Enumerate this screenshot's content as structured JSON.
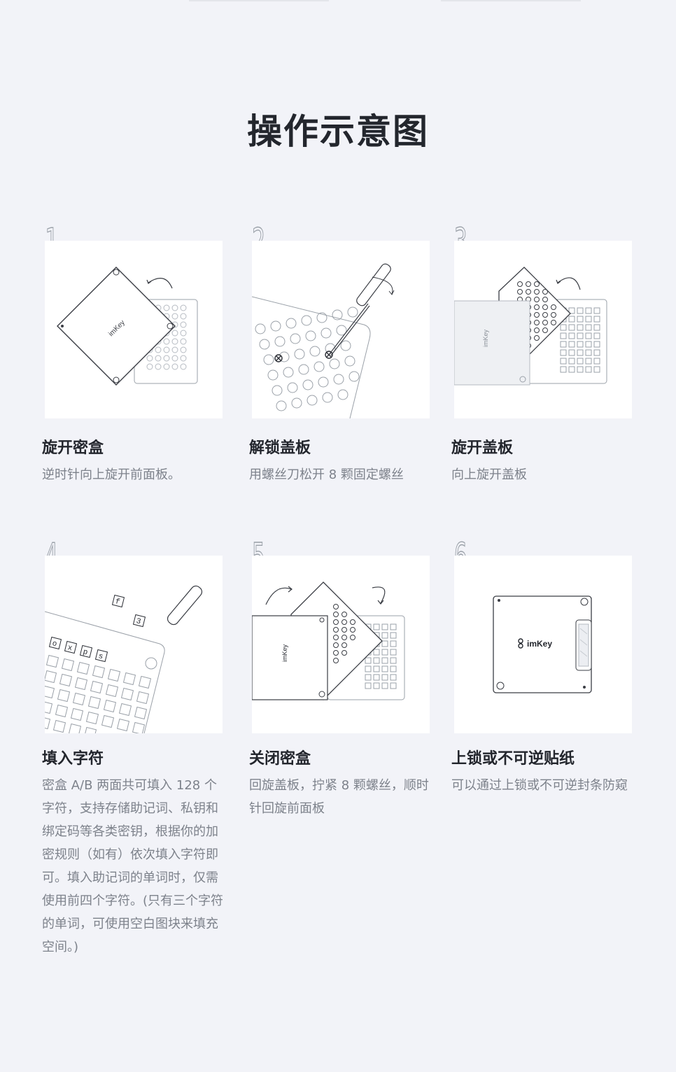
{
  "page": {
    "title": "操作示意图"
  },
  "steps": [
    {
      "number": "1",
      "title": "旋开密盒",
      "desc": "逆时针向上旋开前面板。",
      "brand": "imKey"
    },
    {
      "number": "2",
      "title": "解锁盖板",
      "desc": "用螺丝刀松开 8 颗固定螺丝"
    },
    {
      "number": "3",
      "title": "旋开盖板",
      "desc": "向上旋开盖板",
      "brand": "imKey"
    },
    {
      "number": "4",
      "title": "填入字符",
      "desc": "密盒 A/B 两面共可填入 128 个字符，支持存储助记词、私钥和绑定码等各类密钥，根据你的加密规则（如有）依次填入字符即可。填入助记词的单词时，仅需使用前四个字符。(只有三个字符的单词，可使用空白图块来填充空间。)",
      "tiles": [
        "o",
        "x",
        "p",
        "s"
      ],
      "loose_tiles": [
        "f",
        "3"
      ]
    },
    {
      "number": "5",
      "title": "关闭密盒",
      "desc": "回旋盖板，拧紧 8 颗螺丝，顺时针回旋前面板",
      "brand": "imKey"
    },
    {
      "number": "6",
      "title": "上锁或不可逆贴纸",
      "desc": "可以通过上锁或不可逆封条防窥",
      "brand": "imKey"
    }
  ],
  "colors": {
    "background": "#f2f3f8",
    "panel": "#ffffff",
    "line": "#3a3d44",
    "muted": "#7d828b"
  }
}
